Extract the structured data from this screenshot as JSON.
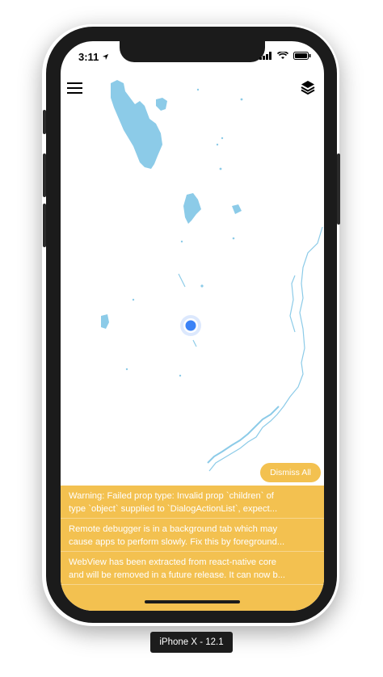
{
  "status_bar": {
    "time": "3:11",
    "location_icon": "location-arrow-icon",
    "wifi_icon": "wifi-icon",
    "battery_icon": "battery-icon"
  },
  "toolbar": {
    "menu_icon": "hamburger-menu-icon",
    "layers_icon": "layers-icon"
  },
  "map": {
    "water_color": "#8ccbe8",
    "location_color": "#3b82f6"
  },
  "warnings": {
    "dismiss_label": "Dismiss All",
    "accent_color": "#f3c150",
    "items": [
      {
        "line1": "Warning: Failed prop type: Invalid prop `children` of",
        "line2": "type `object` supplied to `DialogActionList`, expect..."
      },
      {
        "line1": "Remote debugger is in a background tab which may",
        "line2": "cause apps to perform slowly. Fix this by foreground..."
      },
      {
        "line1": "WebView has been extracted from react-native core",
        "line2": "and will be removed in a future release. It can now b..."
      }
    ]
  },
  "device_label": "iPhone X - 12.1"
}
